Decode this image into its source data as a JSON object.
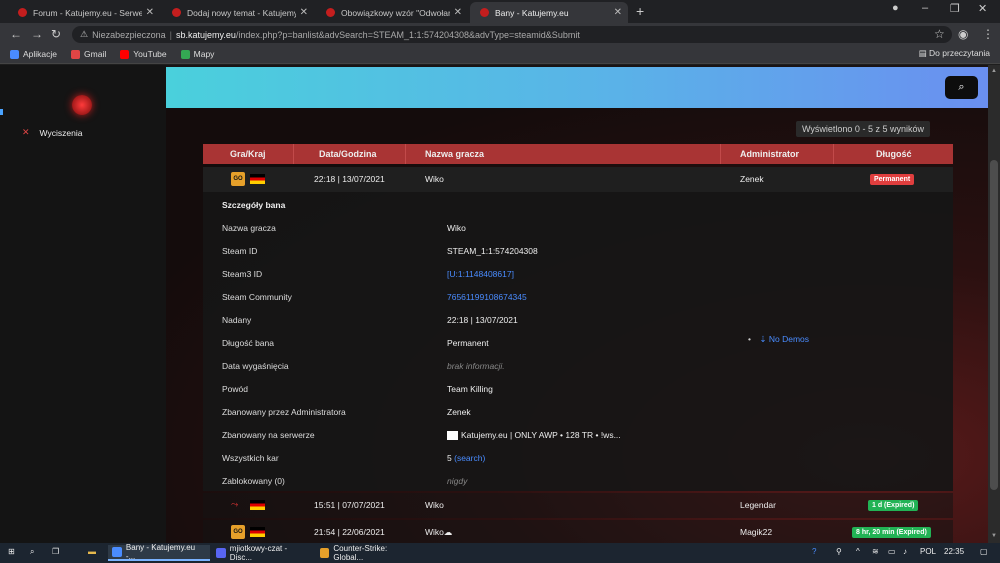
{
  "browser": {
    "tabs": [
      {
        "title": "Forum - Katujemy.eu - Serwery C"
      },
      {
        "title": "Dodaj nowy temat - Katujemy.eu"
      },
      {
        "title": "Obowiązkowy wzór \"Odwołanie"
      },
      {
        "title": "Bany - Katujemy.eu"
      }
    ],
    "address": {
      "security": "Niezabezpieczona",
      "host": "sb.katujemy.eu",
      "path": "/index.php?p=banlist&advSearch=STEAM_1:1:574204308&advType=steamid&Submit"
    },
    "bookmarks": [
      {
        "label": "Aplikacje",
        "color": "#4a8cff"
      },
      {
        "label": "Gmail",
        "color": "#e04545"
      },
      {
        "label": "YouTube",
        "color": "#ff0000"
      },
      {
        "label": "Mapy",
        "color": "#34a853"
      }
    ],
    "reading_list": "Do przeczytania"
  },
  "sidebar": {
    "items": [
      {
        "label": "Wyciszenia",
        "icon": "mic-muted-icon"
      }
    ]
  },
  "banlist": {
    "showing": "Wyświetlono 0 - 5 z 5 wyników",
    "columns": [
      "Gra/Kraj",
      "Data/Godzina",
      "Nazwa gracza",
      "Administrator",
      "Długość"
    ],
    "rows": [
      {
        "date": "22:18 | 13/07/2021",
        "player": "Wiko",
        "admin": "Zenek",
        "length": "Permanent",
        "length_color": "#e03e3e"
      },
      {
        "date": "15:51 | 07/07/2021",
        "player": "Wiko",
        "admin": "Legendar",
        "length": "1 d (Expired)",
        "length_color": "#22b355"
      },
      {
        "date": "21:54 | 22/06/2021",
        "player": "Wiko☁",
        "admin": "Magik22",
        "length": "8 hr, 20 min (Expired)",
        "length_color": "#22b355"
      }
    ],
    "details": {
      "title": "Szczegóły bana",
      "fields": [
        {
          "label": "Nazwa gracza",
          "value": "Wiko"
        },
        {
          "label": "Steam ID",
          "value": "STEAM_1:1:574204308"
        },
        {
          "label": "Steam3 ID",
          "value": "[U:1:1148408617]"
        },
        {
          "label": "Steam Community",
          "value": "76561199108674345"
        },
        {
          "label": "Nadany",
          "value": "22:18 | 13/07/2021"
        },
        {
          "label": "Długość bana",
          "value": "Permanent"
        },
        {
          "label": "Data wygaśnięcia",
          "value": "brak informacji."
        },
        {
          "label": "Powód",
          "value": "Team Killing"
        },
        {
          "label": "Zbanowany przez Administratora",
          "value": "Zenek"
        },
        {
          "label": "Zbanowany na serwerze",
          "value": "Katujemy.eu | ONLY AWP • 128 TR • !ws..."
        },
        {
          "label": "Wszystkich kar",
          "value": "5",
          "extra": "(search)"
        },
        {
          "label": "Zablokowany (0)",
          "value": "nigdy"
        }
      ],
      "demos": "No Demos"
    }
  },
  "taskbar": {
    "items": [
      {
        "label": "Bany - Katujemy.eu -..."
      },
      {
        "label": "mjiotkowy-czat - Disc..."
      },
      {
        "label": "Counter-Strike: Global..."
      }
    ],
    "lang": "POL",
    "time": "22:35"
  }
}
